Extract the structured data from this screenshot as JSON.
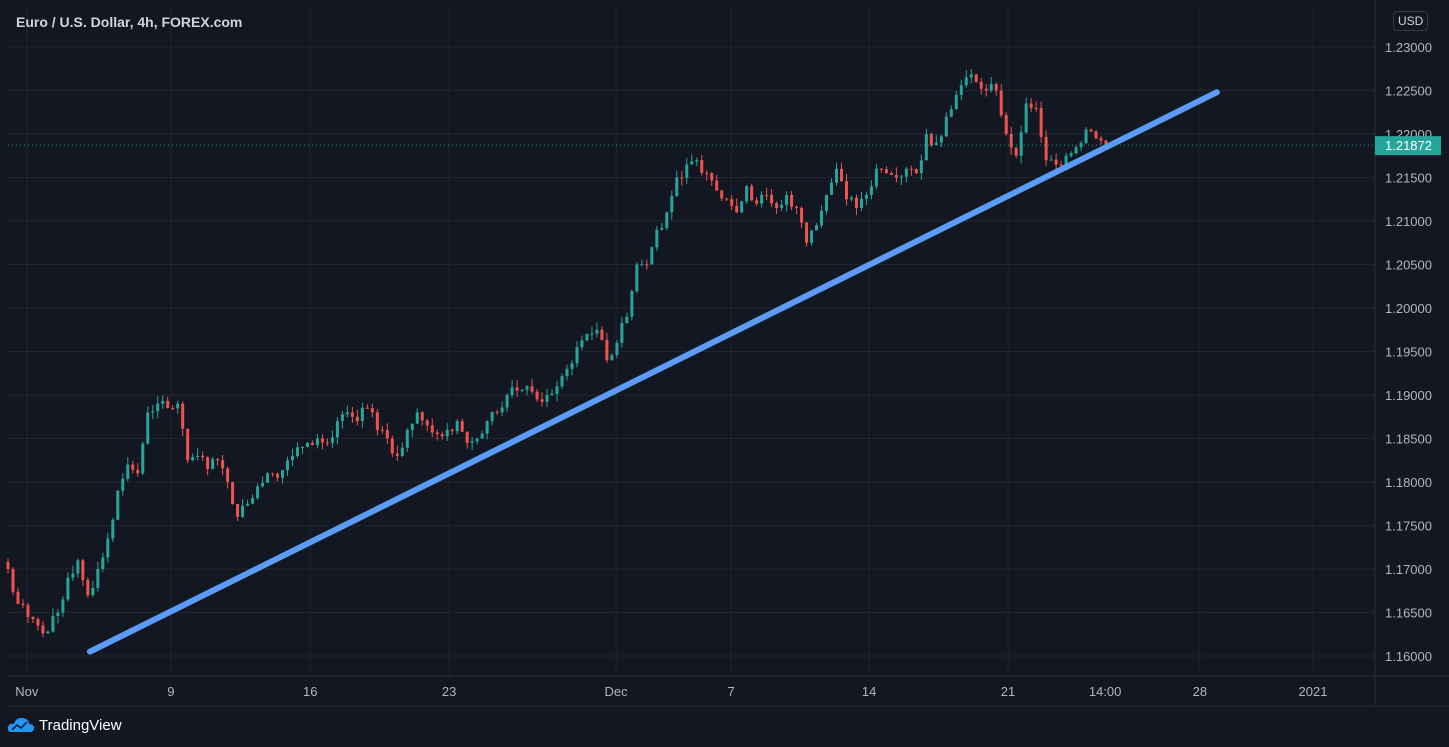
{
  "header": {
    "title": "Euro / U.S. Dollar, 4h, FOREX.com",
    "currency": "USD"
  },
  "branding": {
    "logo_text": "TradingView"
  },
  "colors": {
    "background": "#131722",
    "grid": "#1f2430",
    "up": "#26a69a",
    "down": "#ef5350",
    "trendline": "#5b9cf6",
    "axis_text": "#b2b5be"
  },
  "chart_data": {
    "type": "candlestick",
    "title": "Euro / U.S. Dollar, 4h, FOREX.com",
    "bar_step": 2.17,
    "closes": [
      1.17,
      1.166,
      1.1645,
      1.1635,
      1.1628,
      1.165,
      1.169,
      1.171,
      1.167,
      1.17,
      1.1735,
      1.179,
      1.182,
      1.181,
      1.188,
      1.189,
      1.1885,
      1.189,
      1.1825,
      1.183,
      1.1815,
      1.1825,
      1.18,
      1.176,
      1.1775,
      1.1795,
      1.181,
      1.1805,
      1.1825,
      1.184,
      1.1845,
      1.185,
      1.1845,
      1.187,
      1.188,
      1.187,
      1.1885,
      1.186,
      1.185,
      1.183,
      1.186,
      1.188,
      1.1865,
      1.1855,
      1.186,
      1.187,
      1.1845,
      1.185,
      1.187,
      1.188,
      1.19,
      1.1905,
      1.191,
      1.1895,
      1.19,
      1.191,
      1.193,
      1.1955,
      1.197,
      1.1975,
      1.194,
      1.196,
      1.199,
      1.205,
      1.205,
      1.209,
      1.211,
      1.215,
      1.2165,
      1.217,
      1.2155,
      1.2135,
      1.2125,
      1.211,
      1.214,
      1.212,
      1.213,
      1.2115,
      1.213,
      1.2115,
      1.2075,
      1.2095,
      1.213,
      1.216,
      1.2125,
      1.2115,
      1.213,
      1.216,
      1.2155,
      1.215,
      1.216,
      1.2155,
      1.22,
      1.219,
      1.222,
      1.2245,
      1.2265,
      1.226,
      1.225,
      1.225,
      1.22,
      1.2175,
      1.2235,
      1.223,
      1.217,
      1.2165,
      1.2175,
      1.2185,
      1.2205,
      1.2195,
      1.21872
    ],
    "last_price": "1.21872",
    "yaxis": {
      "ticks": [
        "1.16000",
        "1.16500",
        "1.17000",
        "1.17500",
        "1.18000",
        "1.18500",
        "1.19000",
        "1.19500",
        "1.20000",
        "1.20500",
        "1.21000",
        "1.21500",
        "1.22000",
        "1.22500",
        "1.23000"
      ],
      "range": [
        1.1565,
        1.2345
      ]
    },
    "xaxis": {
      "range_bars": [
        0,
        297
      ],
      "ticks": [
        {
          "label": "Nov",
          "bar": 4.1
        },
        {
          "label": "9",
          "bar": 35.4
        },
        {
          "label": "16",
          "bar": 65.7
        },
        {
          "label": "23",
          "bar": 95.9
        },
        {
          "label": "Dec",
          "bar": 132.2
        },
        {
          "label": "7",
          "bar": 157.2
        },
        {
          "label": "14",
          "bar": 187.2
        },
        {
          "label": "21",
          "bar": 217.4
        },
        {
          "label": "14:00",
          "bar": 238.5
        },
        {
          "label": "28",
          "bar": 259.1
        },
        {
          "label": "2021",
          "bar": 283.7
        }
      ]
    },
    "trendline": {
      "start": {
        "bar": 17.8,
        "price": 1.1605
      },
      "end": {
        "bar": 262.8,
        "price": 1.2248
      }
    }
  }
}
